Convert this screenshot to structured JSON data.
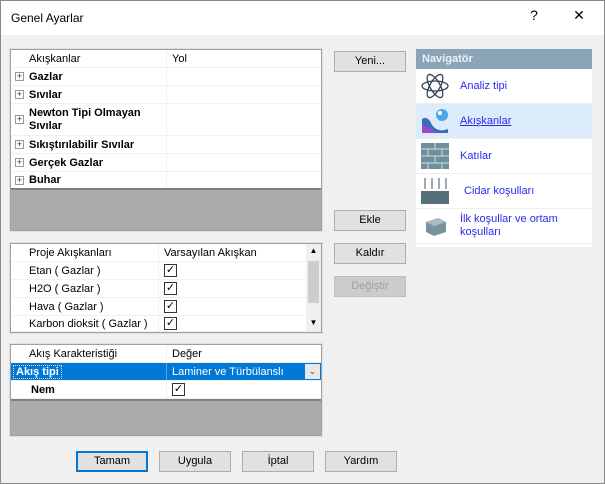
{
  "window": {
    "title": "Genel Ayarlar",
    "help": "?",
    "close": "✕"
  },
  "fluids_tree": {
    "headers": [
      "Akışkanlar",
      "Yol"
    ],
    "rows": [
      "Gazlar",
      "Sıvılar",
      "Newton Tipi Olmayan Sıvılar",
      "Sıkıştırılabilir Sıvılar",
      "Gerçek Gazlar",
      "Buhar"
    ]
  },
  "project_fluids": {
    "headers": [
      "Proje Akışkanları",
      "Varsayılan Akışkan"
    ],
    "rows": [
      {
        "name": "Etan ( Gazlar )",
        "default": true
      },
      {
        "name": "H2O ( Gazlar )",
        "default": true
      },
      {
        "name": "Hava ( Gazlar )",
        "default": true
      },
      {
        "name": "Karbon dioksit ( Gazlar )",
        "default": true
      }
    ]
  },
  "flow": {
    "headers": [
      "Akış Karakteristiği",
      "Değer"
    ],
    "rows": [
      {
        "name": "Akış tipi",
        "value": "Laminer ve Türbülanslı"
      },
      {
        "name": "Nem",
        "checked": true
      }
    ]
  },
  "buttons": {
    "new": "Yeni...",
    "add": "Ekle",
    "remove": "Kaldır",
    "change": "Değiştir",
    "ok": "Tamam",
    "apply": "Uygula",
    "cancel": "İptal",
    "help": "Yardım"
  },
  "navigator": {
    "title": "Navigatör",
    "items": [
      {
        "label": "Analiz tipi",
        "icon": "atom-icon"
      },
      {
        "label": "Akışkanlar",
        "icon": "fluid-drop-icon",
        "selected": true
      },
      {
        "label": "Katılar",
        "icon": "brick-wall-icon"
      },
      {
        "label": "Cidar koşulları",
        "icon": "wall-arrows-icon"
      },
      {
        "label": "İlk koşullar ve ortam koşulları",
        "icon": "block-icon"
      }
    ]
  },
  "colors": {
    "selection": "#0078d7",
    "nav_header": "#8aa5b5",
    "link": "#2a2aee"
  }
}
